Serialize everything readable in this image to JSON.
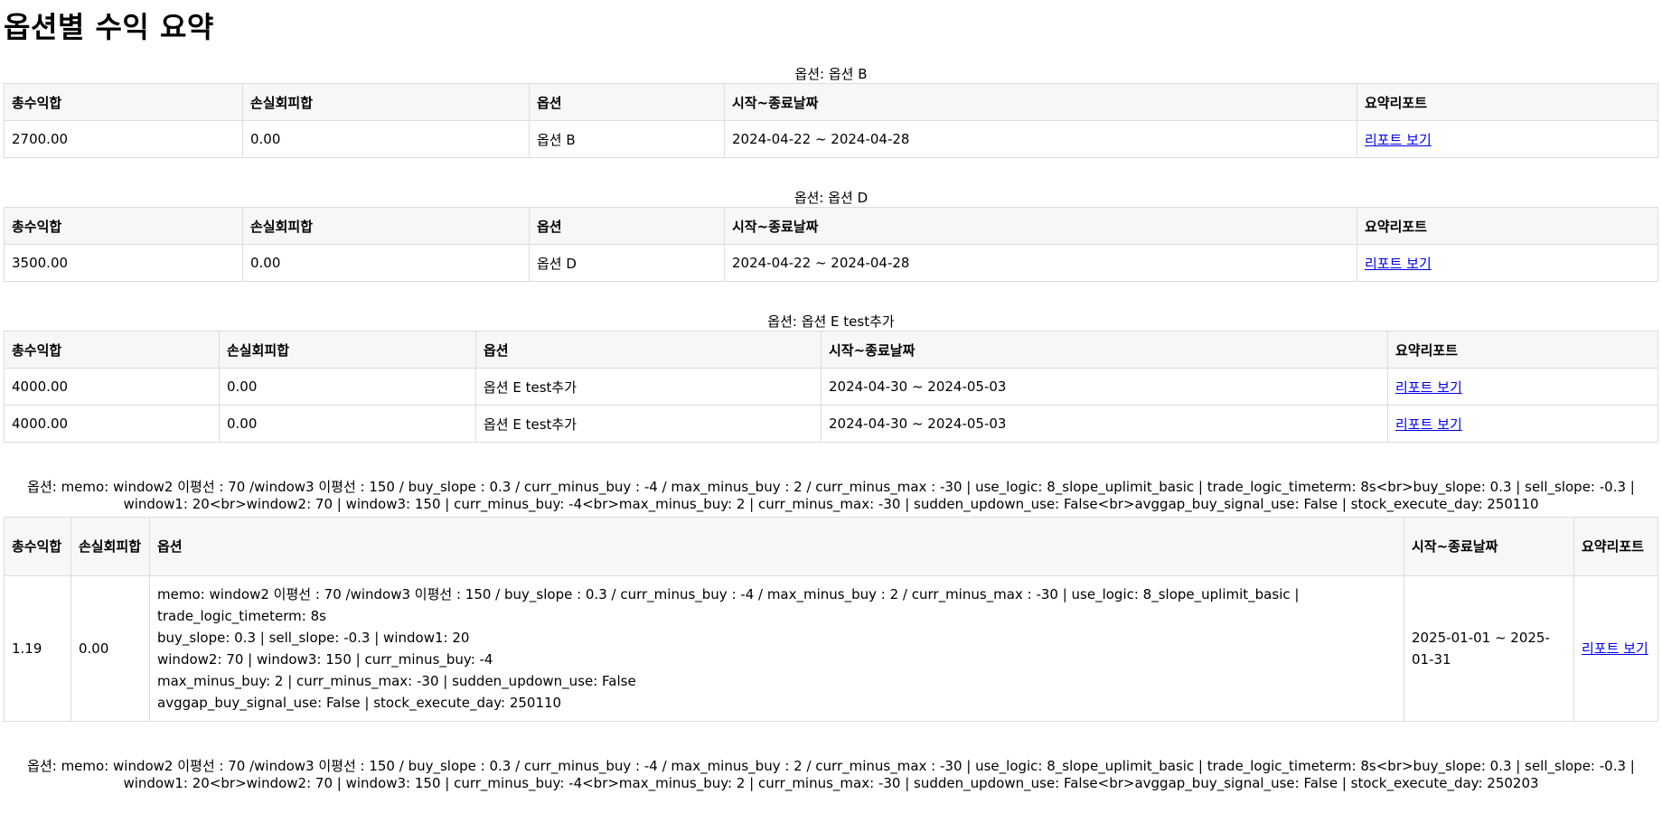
{
  "page_title": "옵션별 수익 요약",
  "headers": [
    "총수익합",
    "손실회피합",
    "옵션",
    "시작~종료날짜",
    "요약리포트"
  ],
  "report_link_label": "리포트 보기",
  "sections": [
    {
      "caption": "옵션: 옵션 B",
      "rows": [
        {
          "total": "2700.00",
          "loss": "0.00",
          "option": "옵션 B",
          "period": "2024-04-22 ~ 2024-04-28"
        }
      ]
    },
    {
      "caption": "옵션: 옵션 D",
      "rows": [
        {
          "total": "3500.00",
          "loss": "0.00",
          "option": "옵션 D",
          "period": "2024-04-22 ~ 2024-04-28"
        }
      ]
    },
    {
      "caption": "옵션: 옵션 E test추가",
      "rows": [
        {
          "total": "4000.00",
          "loss": "0.00",
          "option": "옵션 E test추가",
          "period": "2024-04-30 ~ 2024-05-03"
        },
        {
          "total": "4000.00",
          "loss": "0.00",
          "option": "옵션 E test추가",
          "period": "2024-04-30 ~ 2024-05-03"
        }
      ]
    },
    {
      "caption": "옵션: memo: window2 이평선 : 70 /window3 이평선 : 150 / buy_slope : 0.3 / curr_minus_buy : -4 / max_minus_buy : 2 / curr_minus_max : -30 | use_logic: 8_slope_uplimit_basic | trade_logic_timeterm: 8s<br>buy_slope: 0.3 | sell_slope: -0.3 | window1: 20<br>window2: 70 | window3: 150 | curr_minus_buy: -4<br>max_minus_buy: 2 | curr_minus_max: -30 | sudden_updown_use: False<br>avggap_buy_signal_use: False | stock_execute_day: 250110",
      "rows": [
        {
          "total": "1.19",
          "loss": "0.00",
          "option_lines": [
            "memo: window2 이평선 : 70 /window3 이평선 : 150 / buy_slope : 0.3 / curr_minus_buy : -4 / max_minus_buy : 2 / curr_minus_max : -30 | use_logic: 8_slope_uplimit_basic | trade_logic_timeterm: 8s",
            "buy_slope: 0.3 | sell_slope: -0.3 | window1: 20",
            "window2: 70 | window3: 150 | curr_minus_buy: -4",
            "max_minus_buy: 2 | curr_minus_max: -30 | sudden_updown_use: False",
            "avggap_buy_signal_use: False | stock_execute_day: 250110"
          ],
          "period": "2025-01-01 ~ 2025-01-31"
        }
      ]
    },
    {
      "caption": "옵션: memo: window2 이평선 : 70 /window3 이평선 : 150 / buy_slope : 0.3 / curr_minus_buy : -4 / max_minus_buy : 2 / curr_minus_max : -30 | use_logic: 8_slope_uplimit_basic | trade_logic_timeterm: 8s<br>buy_slope: 0.3 | sell_slope: -0.3 | window1: 20<br>window2: 70 | window3: 150 | curr_minus_buy: -4<br>max_minus_buy: 2 | curr_minus_max: -30 | sudden_updown_use: False<br>avggap_buy_signal_use: False | stock_execute_day: 250203"
    }
  ],
  "colors": {
    "link": "#0000ee",
    "header_bg": "#f7f7f7",
    "border": "#dcdcdc"
  }
}
